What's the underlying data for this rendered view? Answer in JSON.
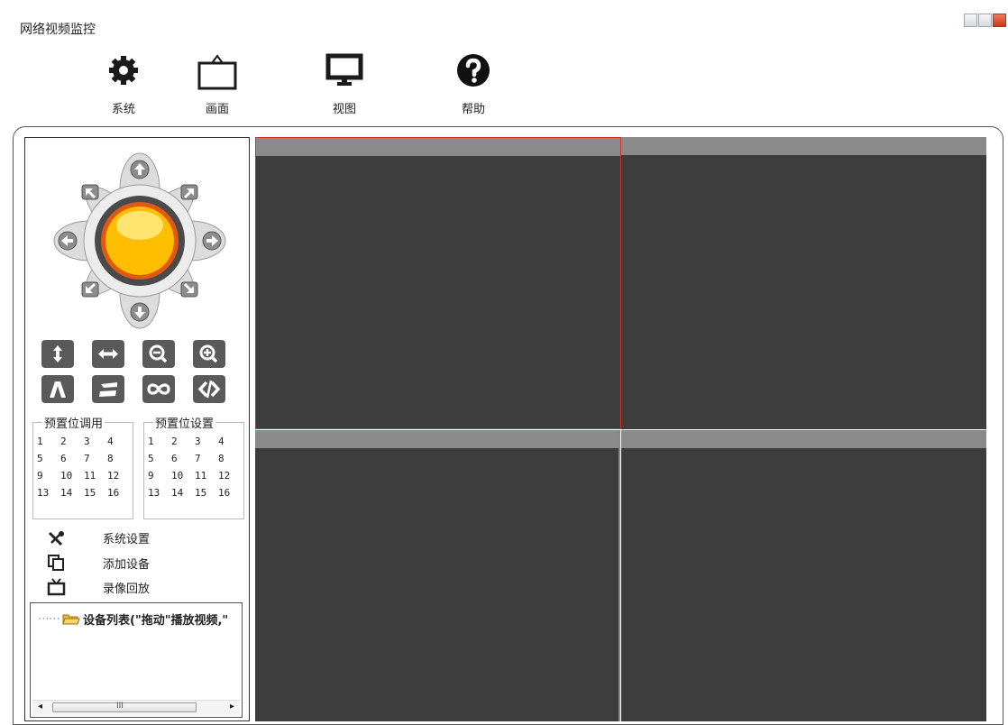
{
  "window": {
    "title": "网络视频监控"
  },
  "toolbar": {
    "system": "系统",
    "screen": "画面",
    "view": "视图",
    "help": "帮助"
  },
  "ptz_icons": [
    "up-arrow-icon",
    "down-arrow-icon",
    "left-arrow-icon",
    "right-arrow-icon",
    "up-left-arrow-icon",
    "up-right-arrow-icon",
    "down-left-arrow-icon",
    "down-right-arrow-icon",
    "center-ball-icon"
  ],
  "function_buttons": [
    {
      "icon": "vertical-flip-icon"
    },
    {
      "icon": "horizontal-flip-icon"
    },
    {
      "icon": "zoom-out-icon"
    },
    {
      "icon": "zoom-in-icon"
    },
    {
      "icon": "focus-near-icon"
    },
    {
      "icon": "focus-far-icon"
    },
    {
      "icon": "infinity-icon"
    },
    {
      "icon": "iris-icon"
    }
  ],
  "preset_call": {
    "title": "预置位调用",
    "numbers": [
      "1",
      "2",
      "3",
      "4",
      "5",
      "6",
      "7",
      "8",
      "9",
      "10",
      "11",
      "12",
      "13",
      "14",
      "15",
      "16"
    ]
  },
  "preset_set": {
    "title": "预置位设置",
    "numbers": [
      "1",
      "2",
      "3",
      "4",
      "5",
      "6",
      "7",
      "8",
      "9",
      "10",
      "11",
      "12",
      "13",
      "14",
      "15",
      "16"
    ]
  },
  "menu": {
    "system_settings": "系统设置",
    "add_device": "添加设备",
    "playback": "录像回放"
  },
  "device_tree": {
    "root": "设备列表(\"拖动\"播放视频,\"",
    "scroll_left": "◂",
    "scroll_right": "▸",
    "thumb": "III"
  },
  "colors": {
    "pane_bg": "#3d3d3d",
    "pane_bar": "#8a8a8a",
    "selected_border": "#d0302a",
    "button_bg": "#5a5a5a"
  }
}
